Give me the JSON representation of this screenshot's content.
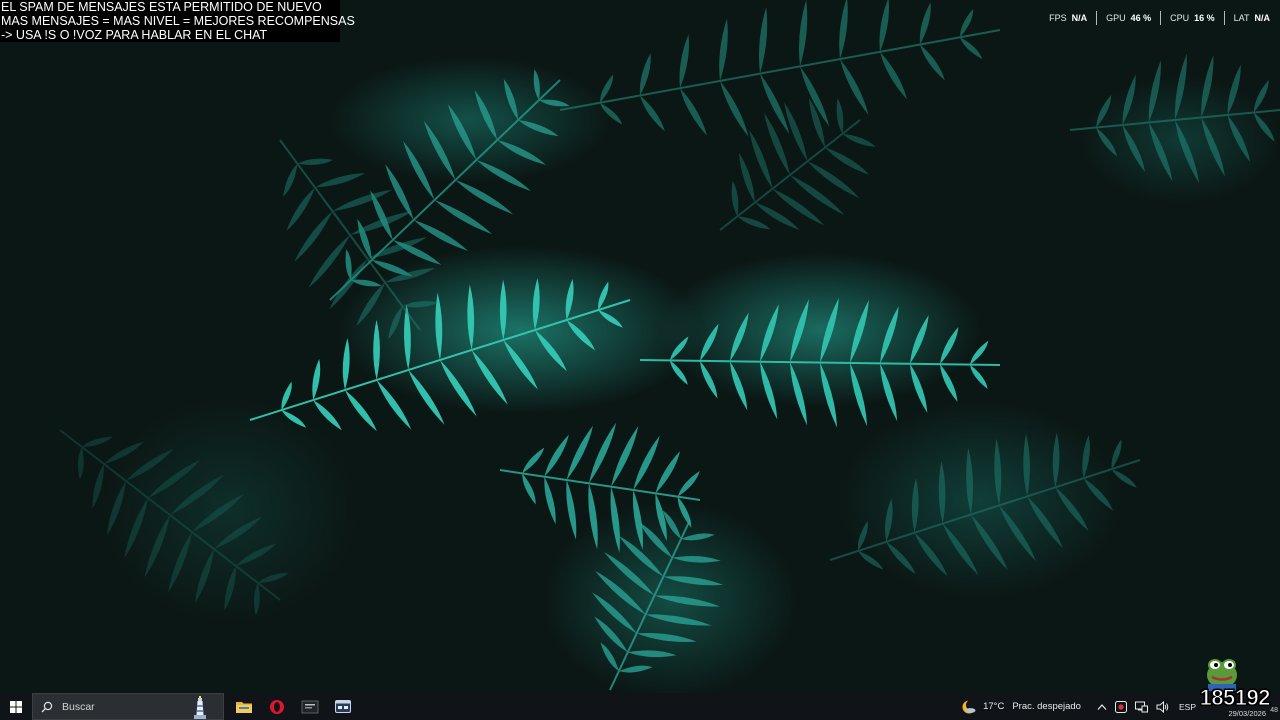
{
  "overlay": {
    "lines": [
      "EL SPAM DE MENSAJES ESTA PERMITIDO DE NUEVO",
      "MAS MENSAJES = MAS NIVEL = MEJORES RECOMPENSAS",
      "-> USA !S  O !VOZ PARA HABLAR EN EL CHAT"
    ]
  },
  "perf": {
    "fps_label": "FPS",
    "fps_value": "N/A",
    "gpu_label": "GPU",
    "gpu_value": "46 %",
    "cpu_label": "CPU",
    "cpu_value": "16 %",
    "lat_label": "LAT",
    "lat_value": "N/A"
  },
  "taskbar": {
    "search_placeholder": "Buscar",
    "apps": [
      "file-explorer-icon",
      "opera-browser-icon",
      "game-app-icon",
      "window-app-icon"
    ]
  },
  "tray": {
    "temperature": "17°C",
    "weather_text": "Prac. despejado",
    "language": "ESP",
    "counter": "185192",
    "date": "29/03/2026",
    "notification_count": "48"
  },
  "colors": {
    "taskbar": "#101418",
    "fern": "#2fc6b3",
    "overlay_bg": "#000000"
  }
}
